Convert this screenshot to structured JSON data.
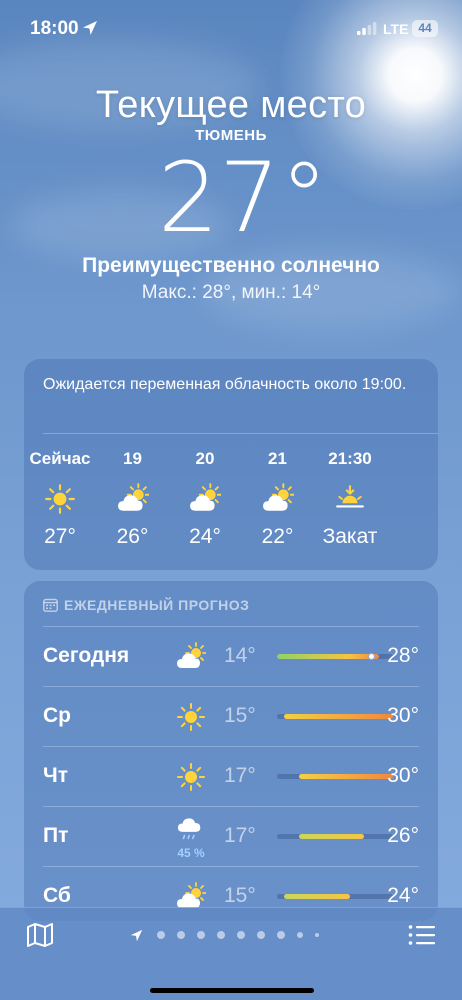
{
  "status_bar": {
    "time": "18:00",
    "network": "LTE",
    "battery": "44"
  },
  "header": {
    "title": "Текущее место",
    "city": "ТЮМЕНЬ",
    "temperature": "27°",
    "condition": "Преимущественно солнечно",
    "hi_lo": "Макс.: 28°, мин.: 14°"
  },
  "hourly": {
    "note": "Ожидается переменная облачность около 19:00.",
    "items": [
      {
        "label": "Сейчас",
        "icon": "sun-icon",
        "temp": "27°"
      },
      {
        "label": "19",
        "icon": "partly-cloudy-icon",
        "temp": "26°"
      },
      {
        "label": "20",
        "icon": "partly-cloudy-icon",
        "temp": "24°"
      },
      {
        "label": "21",
        "icon": "partly-cloudy-icon",
        "temp": "22°"
      },
      {
        "label": "21:30",
        "icon": "sunset-icon",
        "temp": "Закат"
      }
    ]
  },
  "daily": {
    "title": "ЕЖЕДНЕВНЫЙ ПРОГНОЗ",
    "range_min": 14,
    "range_max": 30,
    "current_temp": 27,
    "rows": [
      {
        "day": "Сегодня",
        "icon": "partly-cloudy-icon",
        "precip": "",
        "min": "14°",
        "max": "28°",
        "lo": 14,
        "hi": 28
      },
      {
        "day": "Ср",
        "icon": "sun-icon",
        "precip": "",
        "min": "15°",
        "max": "30°",
        "lo": 15,
        "hi": 30
      },
      {
        "day": "Чт",
        "icon": "sun-icon",
        "precip": "",
        "min": "17°",
        "max": "30°",
        "lo": 17,
        "hi": 30
      },
      {
        "day": "Пт",
        "icon": "rain-cloud-icon",
        "precip": "45 %",
        "min": "17°",
        "max": "26°",
        "lo": 17,
        "hi": 26
      },
      {
        "day": "Сб",
        "icon": "partly-cloudy-icon",
        "precip": "",
        "min": "15°",
        "max": "24°",
        "lo": 15,
        "hi": 24
      }
    ]
  },
  "bottom_bar": {
    "pages": 9,
    "active_page": 0
  },
  "colors": {
    "sun": "#FFD43B",
    "cool": "#8fd16a",
    "mid": "#f5c542",
    "hot": "#f0883e"
  }
}
